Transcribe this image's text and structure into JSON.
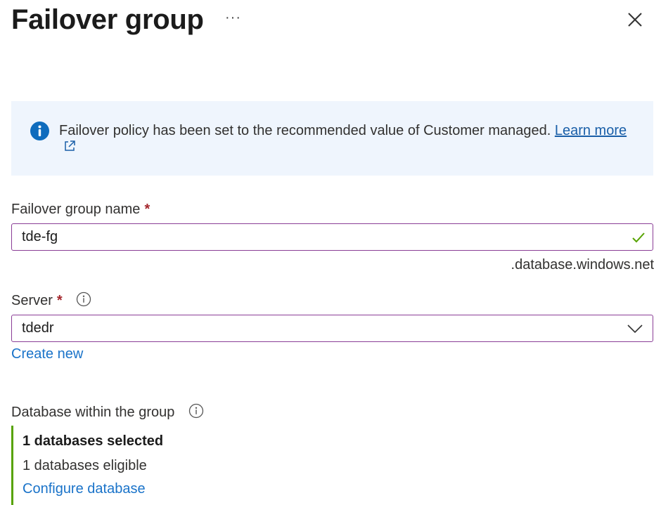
{
  "header": {
    "title": "Failover group",
    "more_label": "···",
    "close_icon": "close-icon"
  },
  "info_banner": {
    "icon": "info-icon",
    "message": "Failover policy has been set to the recommended value of Customer managed.",
    "link_label": "Learn more",
    "link_icon": "external-link-icon",
    "color": "#eff5fd"
  },
  "group_name": {
    "label": "Failover group name",
    "required_mark": "*",
    "value": "tde-fg",
    "suffix": ".database.windows.net",
    "valid_icon": "check-icon"
  },
  "server": {
    "label": "Server",
    "required_mark": "*",
    "info_icon": "info-circle-icon",
    "selected": "tdedr",
    "dropdown_icon": "chevron-down-icon",
    "create_new_label": "Create new"
  },
  "databases": {
    "label": "Database within the group",
    "info_icon": "info-circle-icon",
    "selected_text": "1 databases selected",
    "eligible_text": "1 databases eligible",
    "configure_label": "Configure database",
    "accent_color": "#57a300"
  },
  "colors": {
    "field_border": "#8a3d96",
    "link": "#1a73c9",
    "required": "#a4262c",
    "info": "#0f6cbd"
  }
}
